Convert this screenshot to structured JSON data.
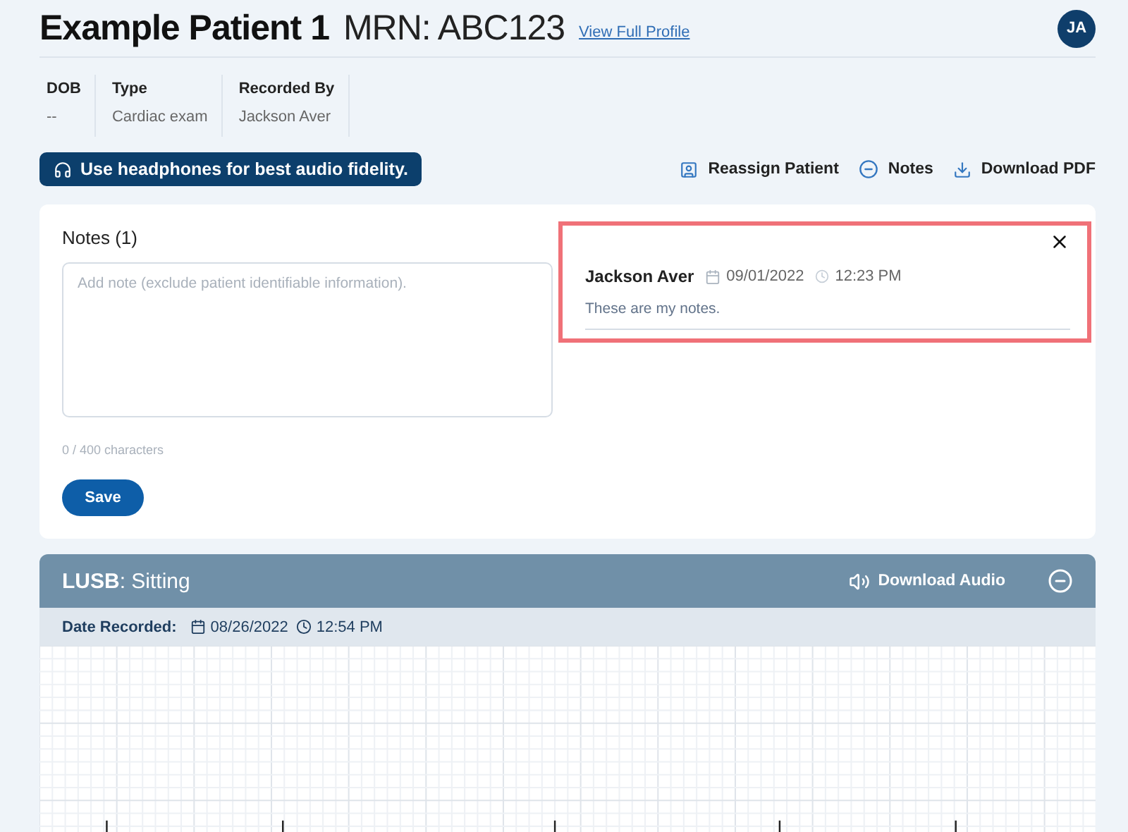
{
  "header": {
    "patient_name": "Example Patient 1",
    "mrn": "MRN: ABC123",
    "profile_link": "View Full Profile",
    "avatar": "JA"
  },
  "info": [
    {
      "label": "DOB",
      "value": "--"
    },
    {
      "label": "Type",
      "value": "Cardiac exam"
    },
    {
      "label": "Recorded By",
      "value": "Jackson Aver"
    }
  ],
  "headphones_banner": "Use headphones for best audio fidelity.",
  "actions": [
    {
      "kind": "reassign",
      "label": "Reassign Patient"
    },
    {
      "kind": "notes",
      "label": "Notes"
    },
    {
      "kind": "download",
      "label": "Download PDF"
    }
  ],
  "notes": {
    "title": "Notes (1)",
    "placeholder": "Add note (exclude patient identifiable information).",
    "counter": "0 / 400 characters",
    "save": "Save",
    "entries": [
      {
        "author": "Jackson Aver",
        "date": "09/01/2022",
        "time": "12:23 PM",
        "text": "These are my notes.",
        "highlighted": true
      }
    ]
  },
  "recording": {
    "site": "LUSB",
    "position": ": Sitting",
    "download": "Download Audio",
    "date_label": "Date Recorded:",
    "date": "08/26/2022",
    "time": "12:54 PM"
  }
}
